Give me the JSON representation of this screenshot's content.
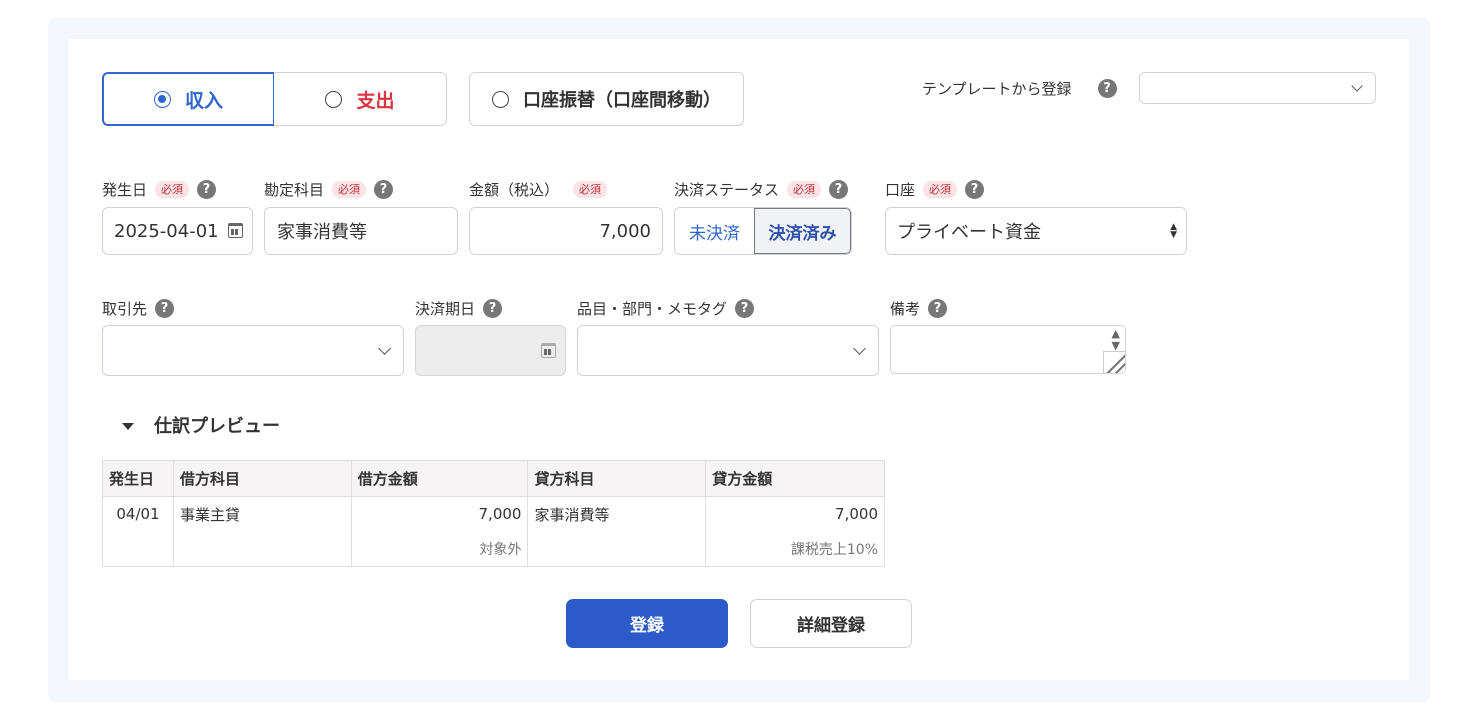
{
  "type_toggle": {
    "income_label": "収入",
    "expense_label": "支出",
    "transfer_label": "口座振替（口座間移動）",
    "selected": "income"
  },
  "template": {
    "label": "テンプレートから登録",
    "value": ""
  },
  "required_badge": "必須",
  "help_glyph": "?",
  "fields": {
    "date": {
      "label": "発生日",
      "value": "2025-04-01"
    },
    "account_title": {
      "label": "勘定科目",
      "value": "家事消費等"
    },
    "amount": {
      "label": "金額（税込）",
      "value": "7,000"
    },
    "settlement": {
      "label": "決済ステータス",
      "unsettled": "未決済",
      "settled": "決済済み",
      "selected": "settled"
    },
    "account": {
      "label": "口座",
      "value": "プライベート資金"
    },
    "partner": {
      "label": "取引先",
      "value": ""
    },
    "due_date": {
      "label": "決済期日",
      "value": ""
    },
    "tags": {
      "label": "品目・部門・メモタグ",
      "value": ""
    },
    "memo": {
      "label": "備考",
      "value": ""
    }
  },
  "journal_preview": {
    "title": "仕訳プレビュー",
    "headers": [
      "発生日",
      "借方科目",
      "借方金額",
      "貸方科目",
      "貸方金額"
    ],
    "row": {
      "date": "04/01",
      "debit_account": "事業主貸",
      "debit_amount": "7,000",
      "debit_tax": "対象外",
      "credit_account": "家事消費等",
      "credit_amount": "7,000",
      "credit_tax": "課税売上10%"
    }
  },
  "buttons": {
    "register": "登録",
    "detail_register": "詳細登録"
  },
  "colors": {
    "accent": "#2f66d0",
    "expense": "#d9333f",
    "primary_button": "#2c5bc9",
    "required_badge_bg": "#fbe3e6"
  }
}
